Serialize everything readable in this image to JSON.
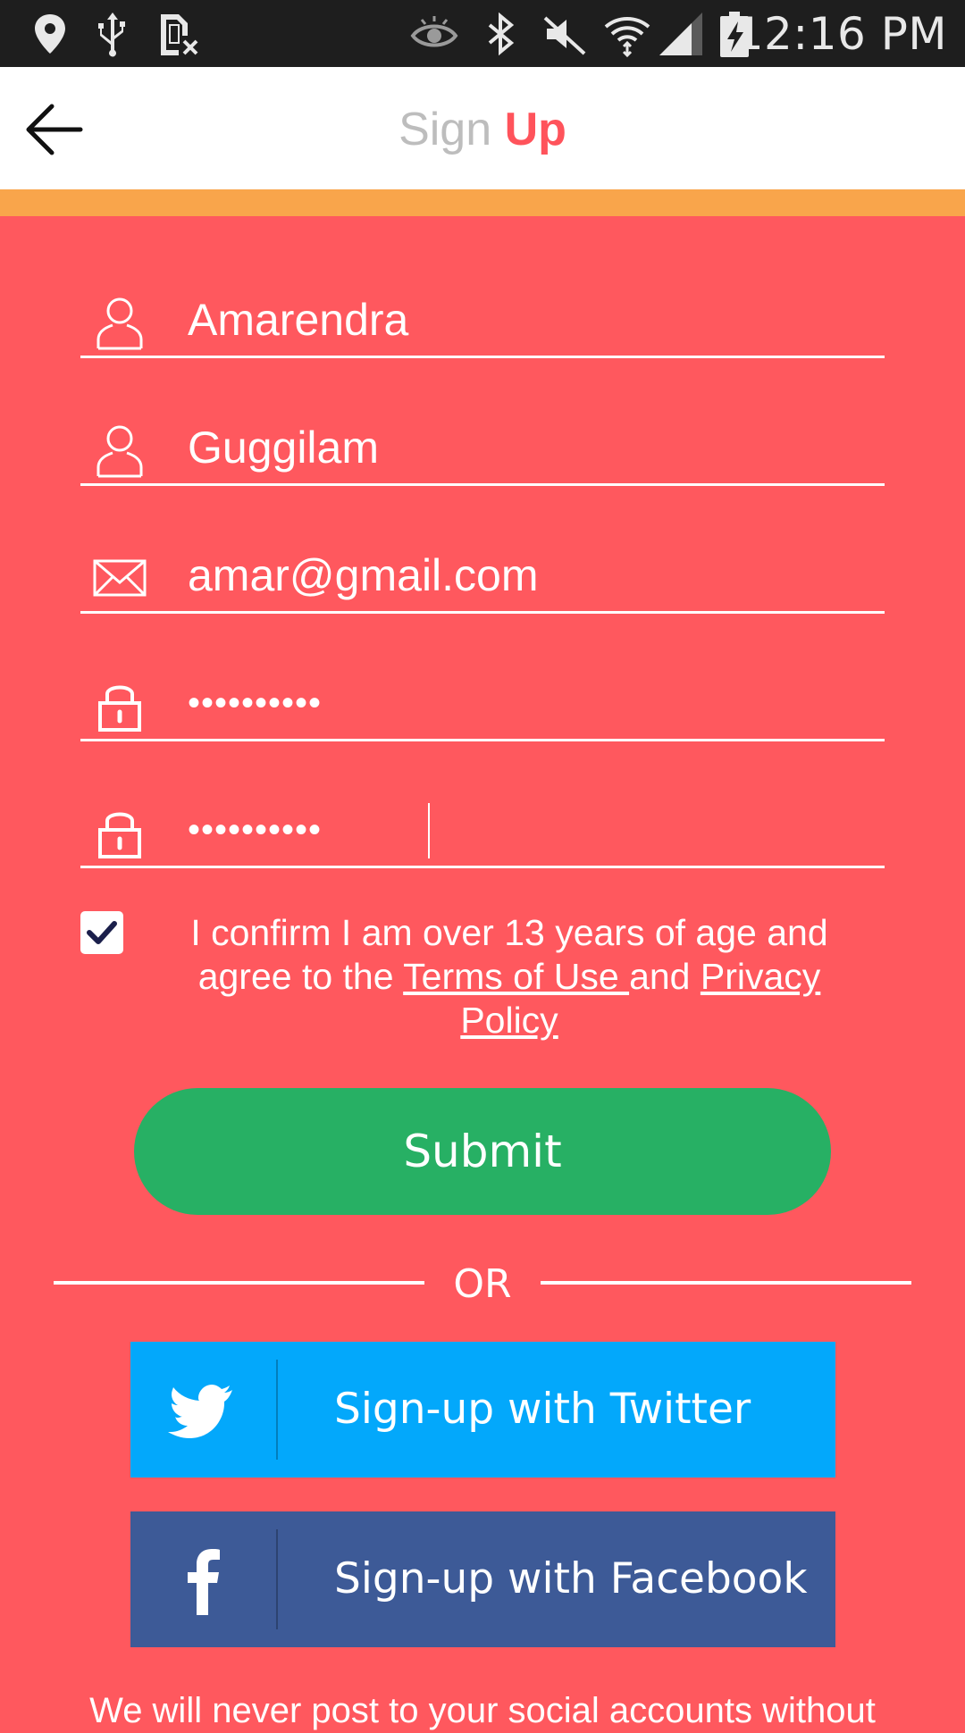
{
  "status_bar": {
    "time": "12:16 PM",
    "icons": [
      "location-icon",
      "usb-icon",
      "no-sim-icon",
      "eye-icon",
      "bluetooth-icon",
      "mute-icon",
      "wifi-icon",
      "signal-icon",
      "battery-charging-icon"
    ]
  },
  "header": {
    "title_part1": "Sign",
    "title_part2": "Up"
  },
  "form": {
    "first_name": "Amarendra",
    "last_name": "Guggilam",
    "email": "amar@gmail.com",
    "password": "••••••••••",
    "confirm_password": "••••••••••"
  },
  "terms": {
    "checked": true,
    "prefix": "I confirm I am over 13 years of age and agree to the ",
    "terms_link": "Terms of Use ",
    "middle": "and ",
    "privacy_link": "Privacy Policy"
  },
  "submit_label": "Submit",
  "or_label": "OR",
  "social": {
    "twitter_label": "Sign-up with Twitter",
    "facebook_label": "Sign-up with Facebook"
  },
  "footer_text": "We will never post to your social accounts without",
  "colors": {
    "background": "#FF585E",
    "accent_bar": "#F9A54B",
    "submit": "#27B064",
    "twitter": "#03A8FB",
    "facebook": "#3D5A97"
  }
}
